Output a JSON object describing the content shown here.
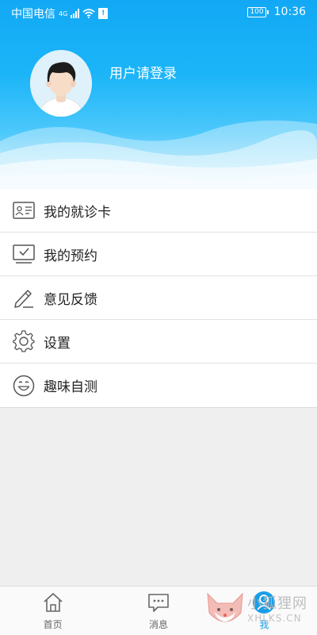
{
  "status_bar": {
    "carrier": "中国电信",
    "network": "4G",
    "sim_label": "!",
    "battery": "100",
    "time": "10:36"
  },
  "profile": {
    "login_prompt": "用户请登录"
  },
  "menu": {
    "items": [
      {
        "label": "我的就诊卡",
        "icon": "id-card-icon"
      },
      {
        "label": "我的预约",
        "icon": "monitor-check-icon"
      },
      {
        "label": "意见反馈",
        "icon": "pencil-icon"
      },
      {
        "label": "设置",
        "icon": "gear-icon"
      },
      {
        "label": "趣味自测",
        "icon": "smiley-icon"
      }
    ]
  },
  "tabbar": {
    "items": [
      {
        "label": "首页",
        "icon": "home-icon"
      },
      {
        "label": "消息",
        "icon": "message-icon"
      },
      {
        "label": "我",
        "icon": "person-icon",
        "active": true
      }
    ]
  },
  "watermark": {
    "text": "小狐狸网",
    "sub": "XHLKS.CN"
  },
  "colors": {
    "header_blue": "#12a8f5",
    "active_tab": "#1a9de8",
    "page_bg": "#efefef"
  }
}
